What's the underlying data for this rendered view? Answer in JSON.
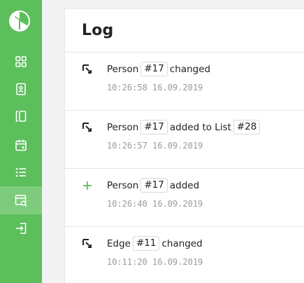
{
  "colors": {
    "sidebar": "#5cbf5c",
    "sidebar_active": "#7ccc7c",
    "add_icon": "#5cbf5c"
  },
  "sidebar": {
    "items": [
      {
        "icon": "dashboard-grid-icon"
      },
      {
        "icon": "person-card-icon"
      },
      {
        "icon": "edges-brackets-icon"
      },
      {
        "icon": "calendar-icon"
      },
      {
        "icon": "list-icon"
      },
      {
        "icon": "log-icon",
        "active": true
      },
      {
        "icon": "logout-icon"
      }
    ]
  },
  "log": {
    "title": "Log",
    "entries": [
      {
        "icon": "edit-arrow-icon",
        "entity": "Person",
        "entity_id": "#17",
        "action": "changed",
        "target": "",
        "target_id": "",
        "timestamp": "10:26:58 16.09.2019"
      },
      {
        "icon": "edit-arrow-icon",
        "entity": "Person",
        "entity_id": "#17",
        "action": "added to List",
        "target": "",
        "target_id": "#28",
        "timestamp": "10:26:57 16.09.2019"
      },
      {
        "icon": "plus-icon",
        "entity": "Person",
        "entity_id": "#17",
        "action": "added",
        "target": "",
        "target_id": "",
        "timestamp": "10:26:40 16.09.2019"
      },
      {
        "icon": "edit-arrow-icon",
        "entity": "Edge",
        "entity_id": "#11",
        "action": "changed",
        "target": "",
        "target_id": "",
        "timestamp": "10:11:20 16.09.2019"
      }
    ]
  }
}
